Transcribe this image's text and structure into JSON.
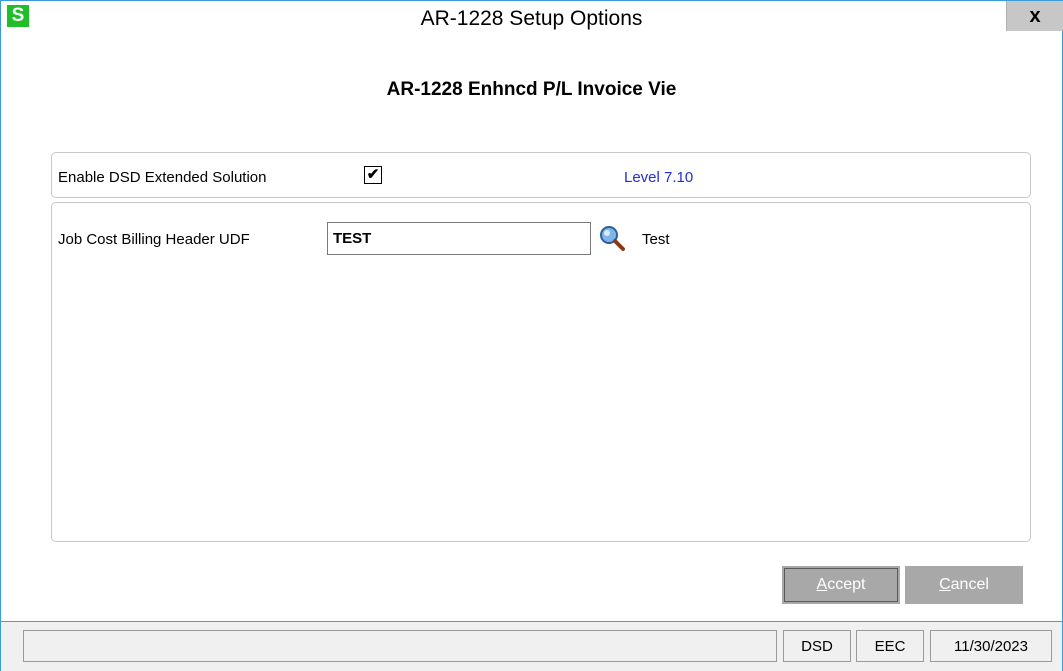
{
  "window": {
    "title": "AR-1228 Setup Options",
    "app_icon_letter": "S",
    "close_glyph": "x"
  },
  "header": {
    "subtitle": "AR-1228 Enhncd P/L Invoice Vie"
  },
  "options": {
    "enable_label": "Enable DSD Extended Solution",
    "enable_checked": true,
    "check_glyph": "✔",
    "level_text": "Level 7.10"
  },
  "udf": {
    "label": "Job Cost Billing Header UDF",
    "value": "TEST",
    "description": "Test",
    "lookup_icon": "magnifier-icon"
  },
  "buttons": {
    "accept_first": "A",
    "accept_rest": "ccept",
    "cancel_first": "C",
    "cancel_rest": "ancel"
  },
  "status_bar": {
    "empty": "",
    "company_code": "DSD",
    "user": "EEC",
    "date": "11/30/2023"
  },
  "colors": {
    "accent_border": "#3b9bd9",
    "app_icon_bg": "#1fbf2a",
    "level_text": "#1f2ed6",
    "button_disabled_bg": "#a8a8a8"
  }
}
